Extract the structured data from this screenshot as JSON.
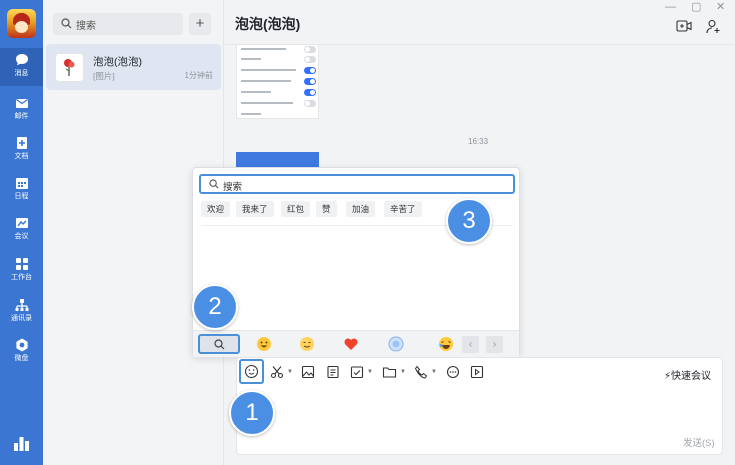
{
  "nav": {
    "items": [
      {
        "label": "消息",
        "icon": "chat-bubble-icon"
      },
      {
        "label": "邮件",
        "icon": "mail-icon"
      },
      {
        "label": "文档",
        "icon": "document-icon"
      },
      {
        "label": "日程",
        "icon": "calendar-icon"
      },
      {
        "label": "会议",
        "icon": "meeting-icon"
      },
      {
        "label": "工作台",
        "icon": "workbench-icon"
      },
      {
        "label": "通讯录",
        "icon": "contacts-icon"
      },
      {
        "label": "微盘",
        "icon": "cloud-drive-icon"
      }
    ],
    "accent": "#3a76d2"
  },
  "list": {
    "search_placeholder": "搜索",
    "conversation": {
      "name": "泡泡(泡泡)",
      "preview": "[图片]",
      "time": "1分钟前"
    }
  },
  "chat": {
    "title": "泡泡(泡泡)",
    "timestamp": "16:33"
  },
  "emoji_panel": {
    "search_placeholder": "搜索",
    "chips": [
      "欢迎",
      "我来了",
      "红包",
      "赞",
      "加油",
      "辛苦了"
    ]
  },
  "input": {
    "quick_meeting": "快速会议",
    "send": "发送(S)"
  },
  "callouts": [
    "1",
    "2",
    "3"
  ]
}
